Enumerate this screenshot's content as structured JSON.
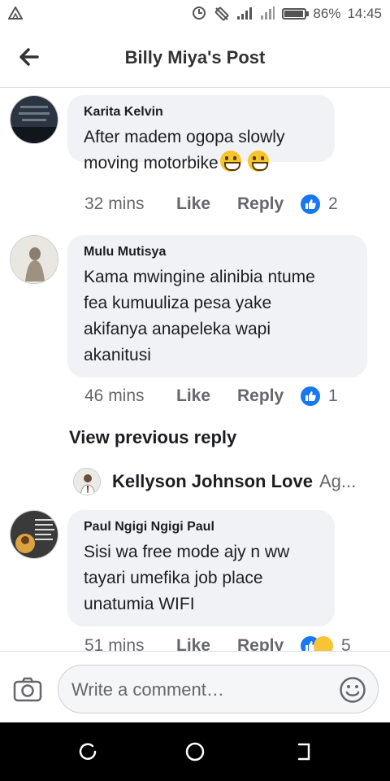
{
  "status_bar": {
    "battery": "86%",
    "time": "14:45",
    "battery_level": 0.86
  },
  "header": {
    "title": "Billy Miya's Post"
  },
  "comments": [
    {
      "author": "Karita Kelvin",
      "text_line1": "After madem ogopa slowly",
      "text_line2": "moving motorbike",
      "time": "32 mins",
      "like_label": "Like",
      "reply_label": "Reply",
      "reaction_count": "2"
    },
    {
      "author": "Mulu Mutisya",
      "text_lines": [
        "Kama mwingine alinibia ntume",
        "fea kumuuliza pesa yake",
        "akifanya anapeleka wapi",
        "akanitusi"
      ],
      "time": "46 mins",
      "like_label": "Like",
      "reply_label": "Reply",
      "reaction_count": "1"
    },
    {
      "author": "Paul Ngigi Ngigi Paul",
      "text_lines": [
        "Sisi wa free mode ajy n ww",
        "tayari umefika job place",
        "unatumia WIFI"
      ],
      "time": "51 mins",
      "like_label": "Like",
      "reply_label": "Reply",
      "reaction_count": "5"
    }
  ],
  "view_previous": "View previous reply",
  "reply_preview": {
    "author": "Kellyson Johnson Love",
    "text": "Ag..."
  },
  "composer": {
    "placeholder": "Write a comment…"
  },
  "colors": {
    "accent": "#1877f2",
    "bubble": "#f0f2f5",
    "meta": "#65676b"
  }
}
